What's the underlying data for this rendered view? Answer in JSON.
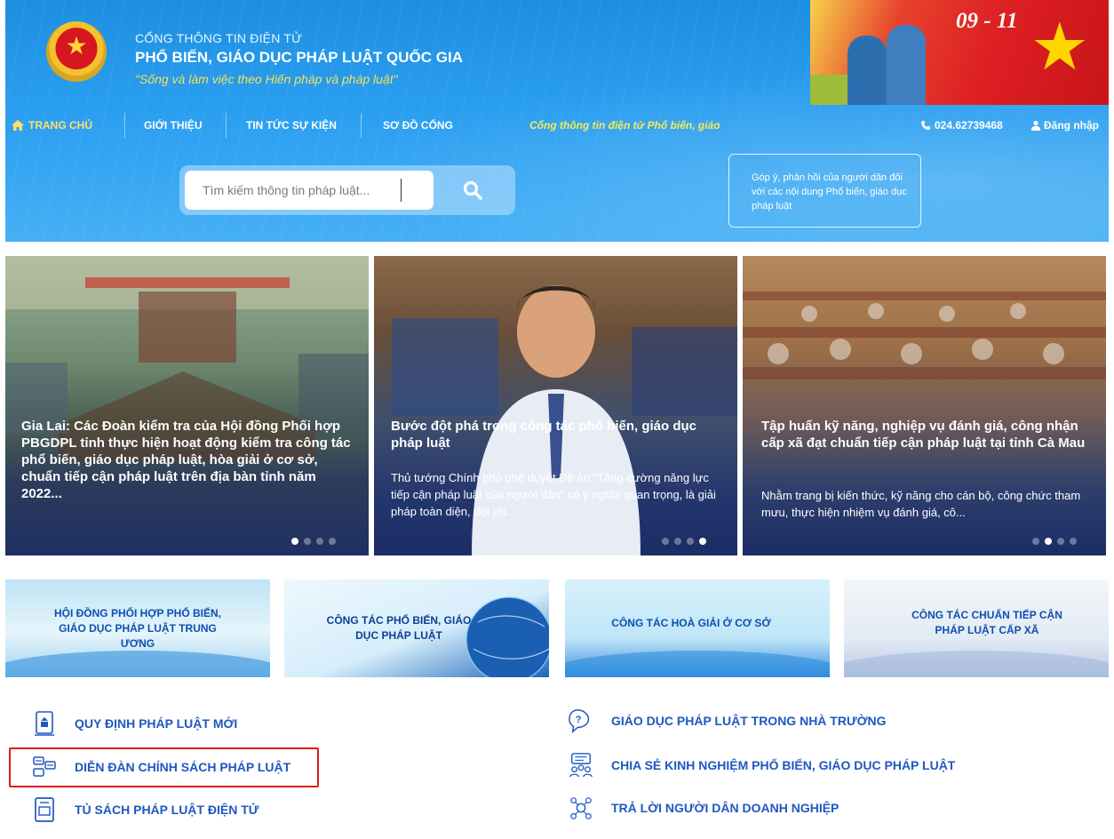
{
  "header": {
    "brand_top": "CỔNG THÔNG TIN ĐIỆN TỬ",
    "brand_main": "PHỔ BIẾN, GIÁO DỤC PHÁP LUẬT QUỐC GIA",
    "slogan": "\"Sống và làm việc theo Hiến pháp và pháp luật\"",
    "banner_date": "09 - 11",
    "colors": {
      "header_blue": "#1d8fe0",
      "slogan_yellow": "#f4e35a",
      "link_blue": "#1f57c3",
      "highlight_red": "#e11a1a"
    }
  },
  "nav": {
    "items": [
      {
        "label": "TRANG CHỦ",
        "icon": "home-icon",
        "active": true
      },
      {
        "label": "GIỚI THIỆU"
      },
      {
        "label": "TIN TỨC SỰ KIỆN"
      },
      {
        "label": "SƠ ĐỒ CỔNG"
      }
    ],
    "marquee": "Cổng thông tin điện tử Phổ biến, giáo",
    "phone": "024.62739468",
    "login": "Đăng nhập"
  },
  "search": {
    "placeholder": "Tìm kiếm thông tin pháp luật...",
    "button_icon": "search-icon"
  },
  "feedback": {
    "text": "Góp ý, phản hồi của người dân đối với các nội dung Phổ biến, giáo dục pháp luật"
  },
  "news": [
    {
      "title": "Gia Lai: Các Đoàn kiểm tra của Hội đồng Phối hợp PBGDPL tỉnh thực hiện hoạt động kiểm tra công tác phổ biến, giáo dục pháp luật, hòa giải ở cơ sở, chuẩn tiếp cận pháp luật trên địa bàn tỉnh năm 2022...",
      "desc": "",
      "dots": 4,
      "active_dot": 1
    },
    {
      "title": "Bước đột phá trong công tác phổ biến, giáo dục pháp luật",
      "desc": "Thủ tướng Chính phủ phê duyệt Đề án \"Tăng cường năng lực tiếp cận pháp luật của người dân\" có ý nghĩa quan trọng, là giải pháp toàn diện, đột ph...",
      "dots": 4,
      "active_dot": 4
    },
    {
      "title": "Tập huấn kỹ năng, nghiệp vụ đánh giá, công nhận cấp xã đạt chuẩn tiếp cận pháp luật tại tỉnh Cà Mau",
      "desc": "Nhằm trang bị kiến thức, kỹ năng cho cán bộ, công chức tham mưu, thực hiện nhiệm vụ đánh giá, cô...",
      "dots": 4,
      "active_dot": 2
    }
  ],
  "categories": [
    {
      "label": "HỘI ĐỒNG PHỐI HỢP PHỔ BIẾN, GIÁO DỤC PHÁP LUẬT TRUNG ƯƠNG"
    },
    {
      "label": "CÔNG TÁC PHỔ BIẾN, GIÁO DỤC PHÁP LUẬT"
    },
    {
      "label": "CÔNG TÁC HOÀ GIẢI Ở CƠ SỞ"
    },
    {
      "label": "CÔNG TÁC CHUẨN TIẾP CẬN PHÁP LUẬT CẤP XÃ"
    }
  ],
  "links": [
    {
      "label": "QUY ĐỊNH PHÁP LUẬT MỚI",
      "icon": "law-book-icon"
    },
    {
      "label": "DIỄN ĐÀN CHÍNH SÁCH PHÁP LUẬT",
      "icon": "forum-icon",
      "highlighted": true
    },
    {
      "label": "TỦ SÁCH PHÁP LUẬT ĐIỆN TỬ",
      "icon": "ebook-icon"
    },
    {
      "label": "GIÁO DỤC PHÁP LUẬT TRONG NHÀ TRƯỜNG",
      "icon": "question-chat-icon"
    },
    {
      "label": "CHIA SẺ KINH NGHIỆM PHỔ BIẾN, GIÁO DỤC PHÁP LUẬT",
      "icon": "share-group-icon"
    },
    {
      "label": "TRẢ LỜI NGƯỜI DÂN DOANH NGHIỆP",
      "icon": "network-users-icon"
    }
  ]
}
